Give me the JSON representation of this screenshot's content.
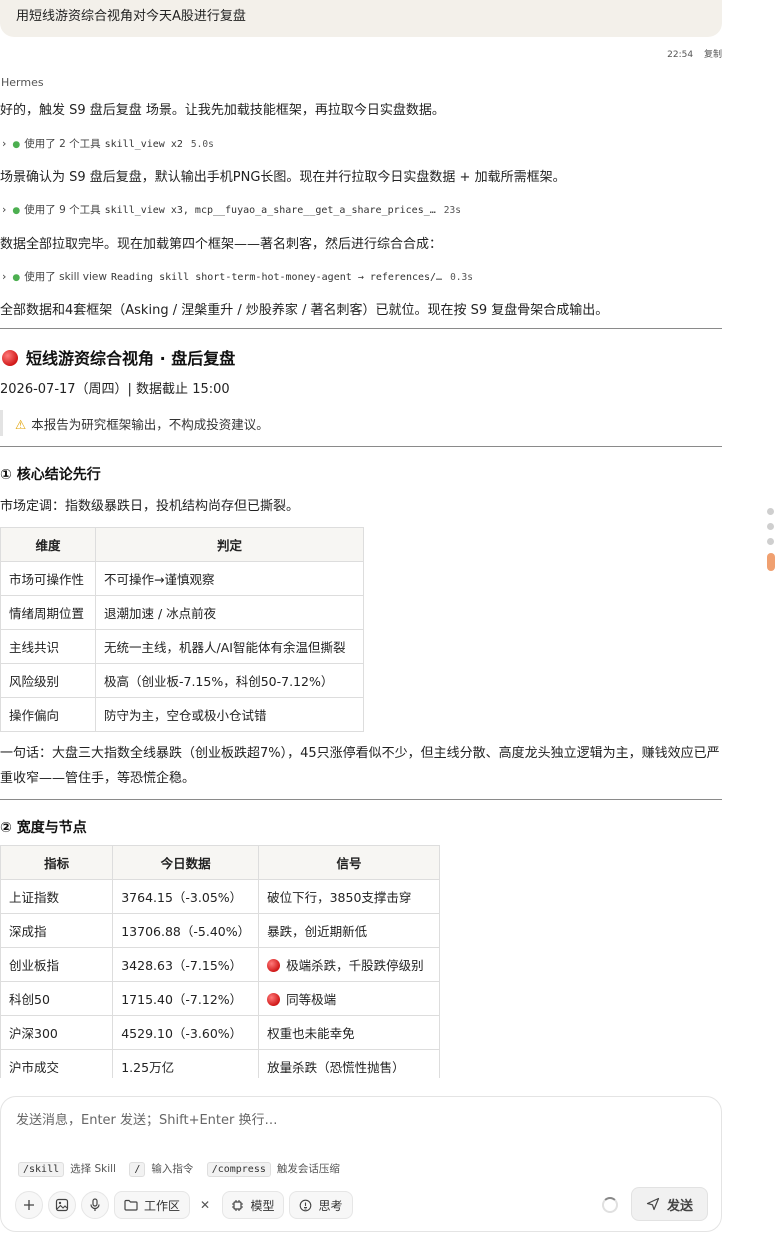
{
  "user_message": {
    "text": "用短线游资综合视角对今天A股进行复盘",
    "time": "22:54",
    "copy_label": "复制"
  },
  "assistant": {
    "sender": "Hermes",
    "line1": "好的，触发 S9 盘后复盘 场景。让我先加载技能框架，再拉取今日实盘数据。",
    "tool1": {
      "label": "使用了 2 个工具",
      "detail": "skill_view x2",
      "time": "5.0s"
    },
    "line2": "场景确认为 S9 盘后复盘，默认输出手机PNG长图。现在并行拉取今日实盘数据 + 加载所需框架。",
    "tool2": {
      "label": "使用了 9 个工具",
      "detail": "skill_view x3, mcp__fuyao_a_share__get_a_share_prices_…",
      "time": "23s"
    },
    "line3": "数据全部拉取完毕。现在加载第四个框架——著名刺客，然后进行综合合成：",
    "tool3": {
      "label": "使用了 skill view",
      "detail": "Reading skill short-term-hot-money-agent → references/…",
      "time": "0.3s"
    },
    "line4": "全部数据和4套框架（Asking / 涅槃重升 / 炒股养家 / 著名刺客）已就位。现在按 S9 复盘骨架合成输出。"
  },
  "report": {
    "title": "短线游资综合视角 · 盘后复盘",
    "date_line": "2026-07-17（周四）| 数据截止 15:00",
    "disclaimer": "本报告为研究框架输出，不构成投资建议。",
    "section1": {
      "heading": "① 核心结论先行",
      "tone": "市场定调：指数级暴跌日，投机结构尚存但已撕裂。",
      "headers": [
        "维度",
        "判定"
      ],
      "rows": [
        [
          "市场可操作性",
          "不可操作→谨慎观察"
        ],
        [
          "情绪周期位置",
          "退潮加速 / 冰点前夜"
        ],
        [
          "主线共识",
          "无统一主线，机器人/AI智能体有余温但撕裂"
        ],
        [
          "风险级别",
          "极高（创业板-7.15%，科创50-7.12%）"
        ],
        [
          "操作偏向",
          "防守为主，空仓或极小仓试错"
        ]
      ],
      "summary": "一句话：大盘三大指数全线暴跌（创业板跌超7%），45只涨停看似不少，但主线分散、高度龙头独立逻辑为主，赚钱效应已严重收窄——管住手，等恐慌企稳。"
    },
    "section2": {
      "heading": "② 宽度与节点",
      "headers": [
        "指标",
        "今日数据",
        "信号"
      ],
      "rows": [
        {
          "name": "上证指数",
          "value": "3764.15（-3.05%）",
          "signal": "破位下行，3850支撑击穿",
          "flag": ""
        },
        {
          "name": "深成指",
          "value": "13706.88（-5.40%）",
          "signal": "暴跌，创近期新低",
          "flag": ""
        },
        {
          "name": "创业板指",
          "value": "3428.63（-7.15%）",
          "signal": "极端杀跌，千股跌停级别",
          "flag": "red"
        },
        {
          "name": "科创50",
          "value": "1715.40（-7.12%）",
          "signal": "同等极端",
          "flag": "red"
        },
        {
          "name": "沪深300",
          "value": "4529.10（-3.60%）",
          "signal": "权重也未能幸免",
          "flag": ""
        },
        {
          "name": "沪市成交",
          "value": "1.25万亿",
          "signal": "放量杀跌（恐慌性抛售）",
          "flag": ""
        }
      ]
    }
  },
  "composer": {
    "placeholder": "发送消息，Enter 发送；Shift+Enter 换行…",
    "hints": [
      {
        "cmd": "/skill",
        "desc": "选择 Skill"
      },
      {
        "cmd": "/",
        "desc": "输入指令"
      },
      {
        "cmd": "/compress",
        "desc": "触发会话压缩"
      }
    ],
    "workspace_label": "工作区",
    "model_label": "模型",
    "think_label": "思考",
    "send_label": "发送"
  },
  "colors": {
    "accent_orange": "#f0a070",
    "red_indicator": "#d01818",
    "success_dot": "#4caf50",
    "warning": "#e0a100"
  },
  "icons": [
    "chevron-right-icon",
    "status-dot-icon",
    "red-circle-icon",
    "warning-icon",
    "plus-icon",
    "image-icon",
    "mic-icon",
    "folder-icon",
    "close-icon",
    "chip-icon",
    "bulb-icon",
    "spinner-icon",
    "send-icon"
  ]
}
